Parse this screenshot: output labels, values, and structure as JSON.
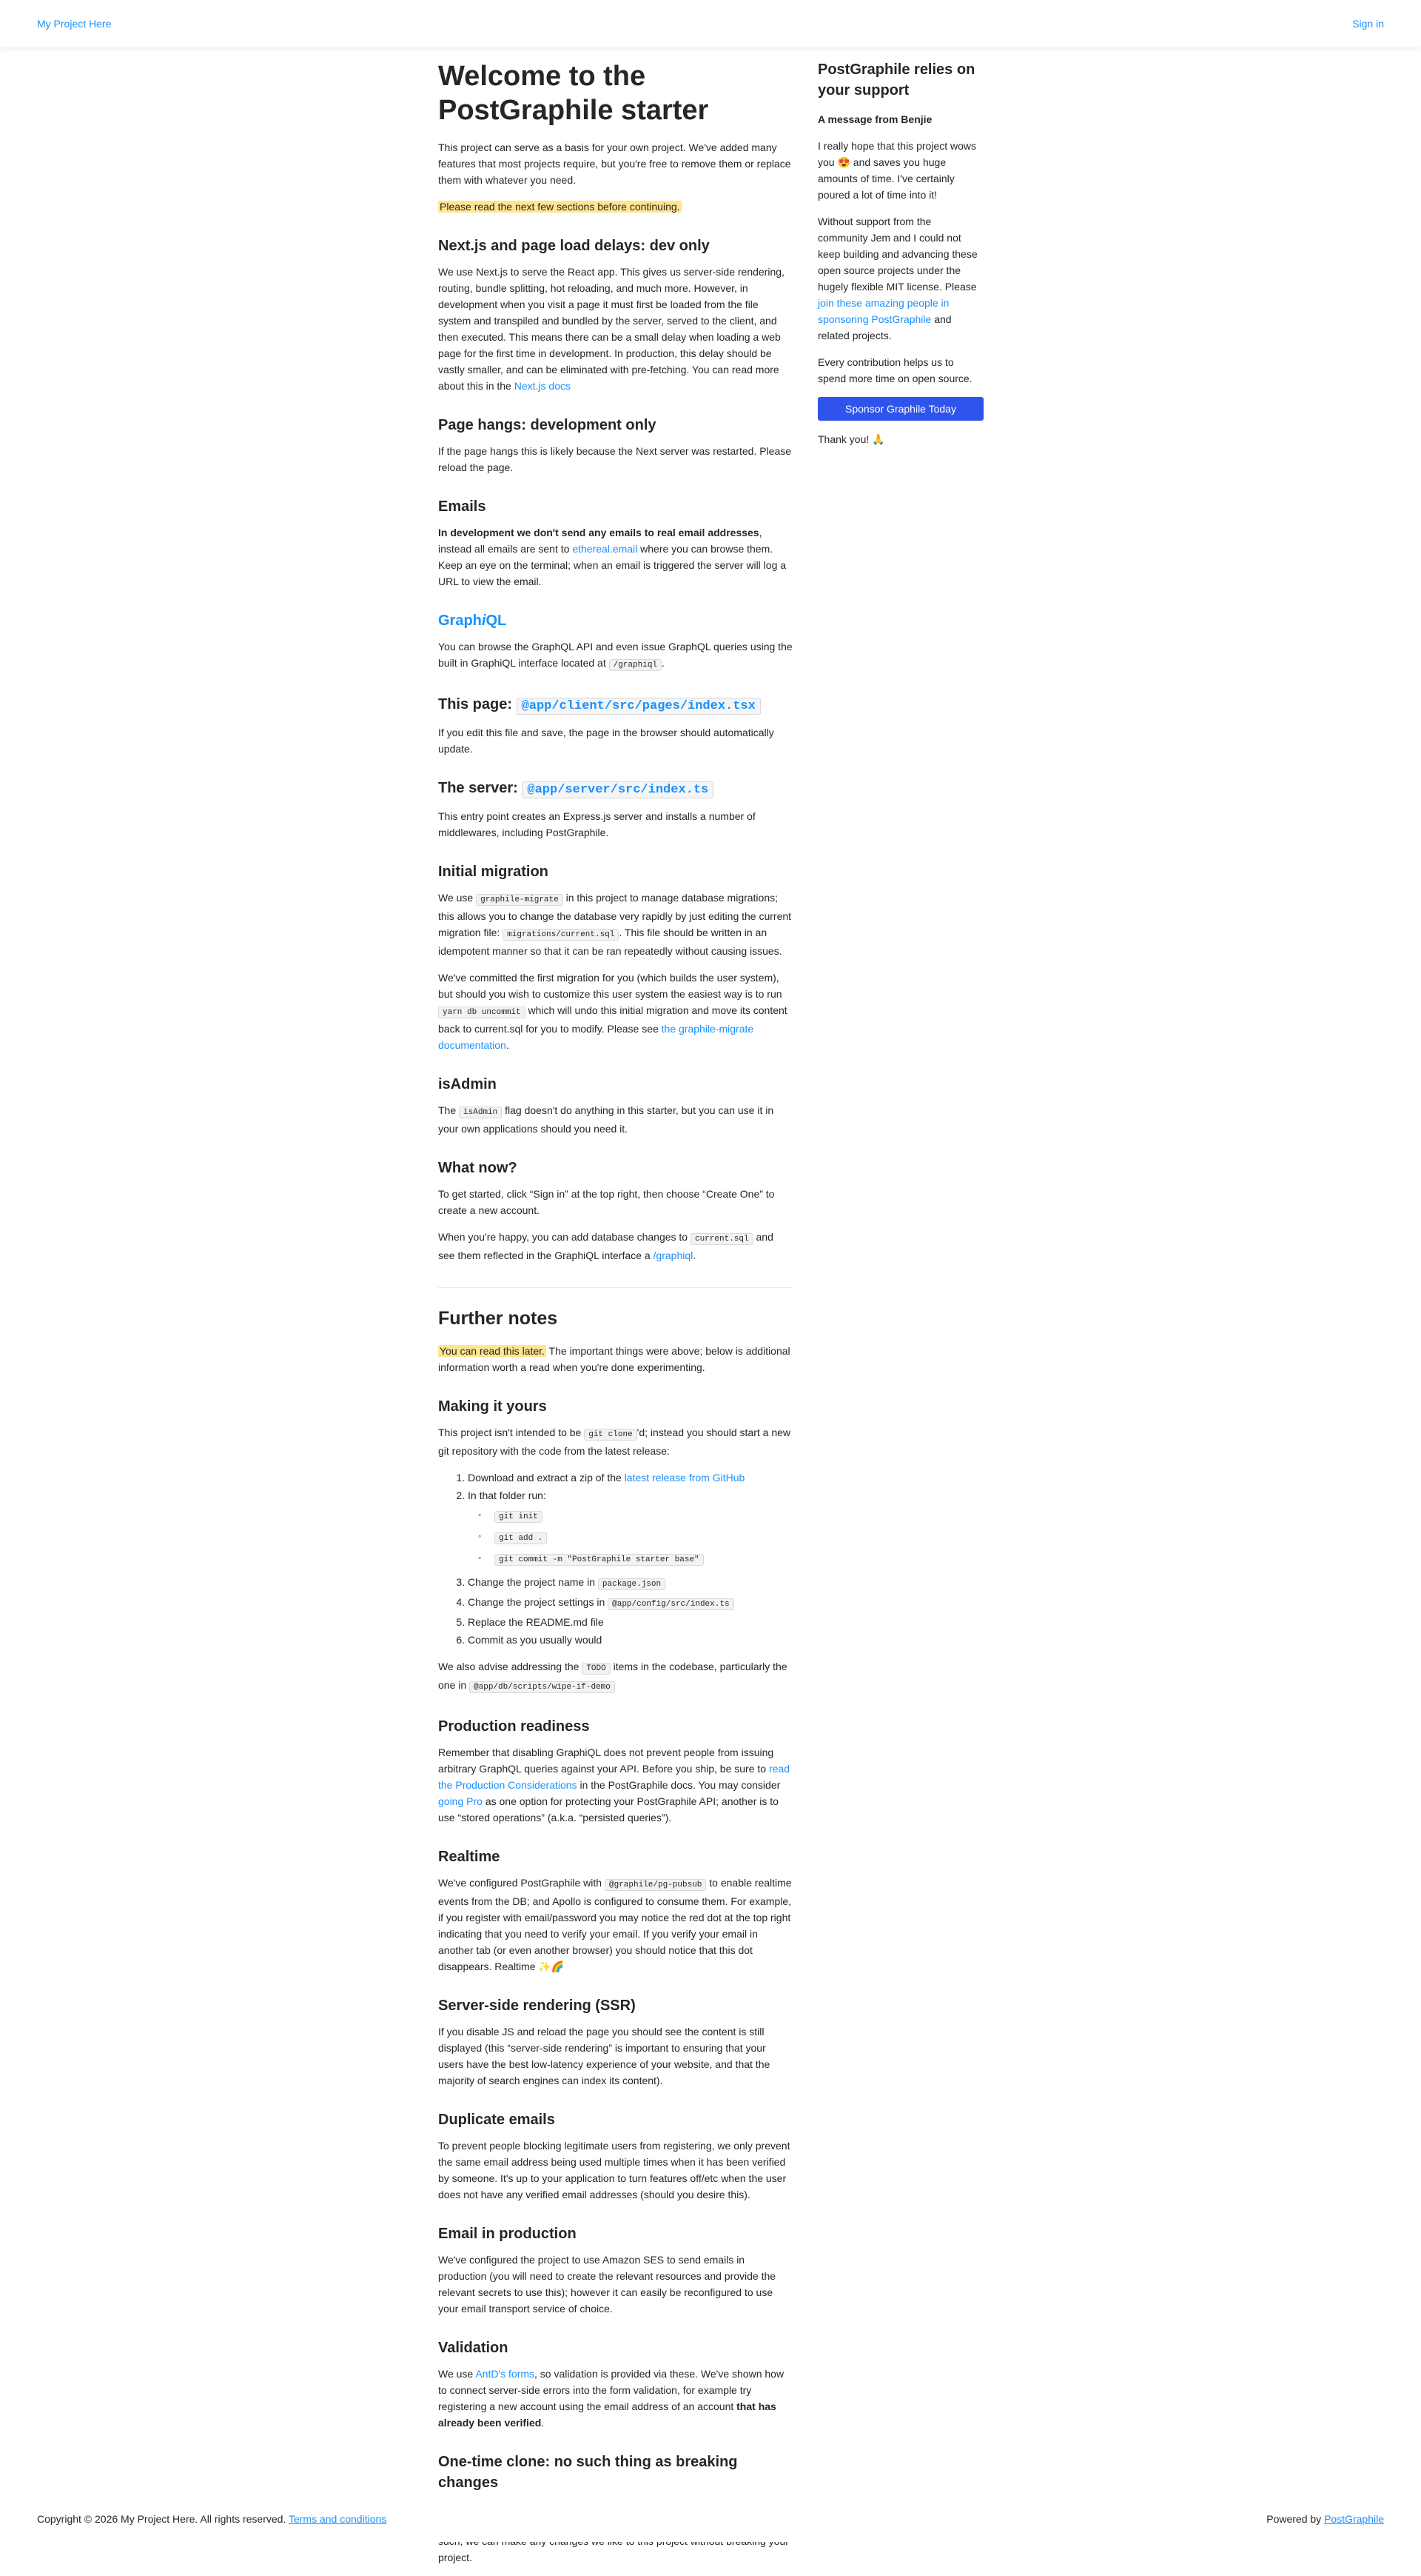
{
  "header": {
    "brand": "My Project Here",
    "signin": "Sign in"
  },
  "main": {
    "title": "Welcome to the PostGraphile starter",
    "intro": "This project can serve as a basis for your own project. We've added many features that most projects require, but you're free to remove them or replace them with whatever you need.",
    "notice": "Please read the next few sections before continuing.",
    "nextjs": {
      "heading": "Next.js and page load delays: dev only",
      "text": "We use Next.js to serve the React app. This gives us server-side rendering, routing, bundle splitting, hot reloading, and much more. However, in development when you visit a page it must first be loaded from the file system and transpiled and bundled by the server, served to the client, and then executed. This means there can be a small delay when loading a web page for the first time in development. In production, this delay should be vastly smaller, and can be eliminated with pre-fetching. You can read more about this in the ",
      "link": "Next.js docs"
    },
    "hangs": {
      "heading": "Page hangs: development only",
      "text": "If the page hangs this is likely because the Next server was restarted. Please reload the page."
    },
    "emails": {
      "heading": "Emails",
      "bold": "In development we don't send any emails to real email addresses",
      "text1": ", instead all emails are sent to ",
      "link": "ethereal.email",
      "text2": " where you can browse them. Keep an eye on the terminal; when an email is triggered the server will log a URL to view the email."
    },
    "graphiql": {
      "heading_a": "Graph",
      "heading_b": "i",
      "heading_c": "QL",
      "text": "You can browse the GraphQL API and even issue GraphQL queries using the built in GraphiQL interface located at ",
      "code": "/graphiql",
      "end": "."
    },
    "thispage": {
      "heading": "This page:",
      "code": "@app/client/src/pages/index.tsx",
      "text": "If you edit this file and save, the page in the browser should automatically update."
    },
    "server": {
      "heading": "The server:",
      "code": "@app/server/src/index.ts",
      "text": "This entry point creates an Express.js server and installs a number of middlewares, including PostGraphile."
    },
    "migration": {
      "heading": "Initial migration",
      "p1a": "We use ",
      "p1code": "graphile-migrate",
      "p1b": " in this project to manage database migrations; this allows you to change the database very rapidly by just editing the current migration file: ",
      "p1code2": "migrations/current.sql",
      "p1c": ". This file should be written in an idempotent manner so that it can be ran repeatedly without causing issues.",
      "p2a": "We've committed the first migration for you (which builds the user system), but should you wish to customize this user system the easiest way is to run ",
      "p2code": "yarn db uncommit",
      "p2b": " which will undo this initial migration and move its content back to current.sql for you to modify. Please see ",
      "p2link": "the graphile-migrate documentation",
      "p2c": "."
    },
    "isadmin": {
      "heading": "isAdmin",
      "a": "The ",
      "code": "isAdmin",
      "b": " flag doesn't do anything in this starter, but you can use it in your own applications should you need it."
    },
    "whatnow": {
      "heading": "What now?",
      "p1": "To get started, click “Sign in” at the top right, then choose “Create One” to create a new account.",
      "p2a": "When you're happy, you can add database changes to ",
      "p2code": "current.sql",
      "p2b": " and see them reflected in the GraphiQL interface a ",
      "p2link": "/graphiql",
      "p2c": "."
    },
    "further": {
      "heading": "Further notes",
      "hl": "You can read this later.",
      "text": " The important things were above; below is additional information worth a read when you're done experimenting."
    },
    "yours": {
      "heading": "Making it yours",
      "p1a": "This project isn't intended to be ",
      "p1code": "git clone",
      "p1b": "'d; instead you should start a new git repository with the code from the latest release:",
      "li1a": "Download and extract a zip of the ",
      "li1link": "latest release from GitHub",
      "li2": "In that folder run:",
      "cmd1": "git init",
      "cmd2": "git add .",
      "cmd3": "git commit -m \"PostGraphile starter base\"",
      "li3a": "Change the project name in ",
      "li3code": "package.json",
      "li4a": "Change the project settings in ",
      "li4code": "@app/config/src/index.ts",
      "li5": "Replace the README.md file",
      "li6": "Commit as you usually would",
      "p2a": "We also advise addressing the ",
      "p2code": "TODO",
      "p2b": " items in the codebase, particularly the one in ",
      "p2code2": "@app/db/scripts/wipe-if-demo"
    },
    "production": {
      "heading": "Production readiness",
      "a": "Remember that disabling GraphiQL does not prevent people from issuing arbitrary GraphQL queries against your API. Before you ship, be sure to ",
      "link1": "read the Production Considerations",
      "b": " in the PostGraphile docs. You may consider ",
      "link2": "going Pro",
      "c": " as one option for protecting your PostGraphile API; another is to use “stored operations” (a.k.a. “persisted queries”)."
    },
    "realtime": {
      "heading": "Realtime",
      "a": "We've configured PostGraphile with ",
      "code": "@graphile/pg-pubsub",
      "b": " to enable realtime events from the DB; and Apollo is configured to consume them. For example, if you register with email/password you may notice the red dot at the top right indicating that you need to verify your email. If you verify your email in another tab (or even another browser) you should notice that this dot disappears. Realtime ✨🌈"
    },
    "ssr": {
      "heading": "Server-side rendering (SSR)",
      "text": "If you disable JS and reload the page you should see the content is still displayed (this “server-side rendering” is important to ensuring that your users have the best low-latency experience of your website, and that the majority of search engines can index its content)."
    },
    "dupes": {
      "heading": "Duplicate emails",
      "text": "To prevent people blocking legitimate users from registering, we only prevent the same email address being used multiple times when it has been verified by someone. It's up to your application to turn features off/etc when the user does not have any verified email addresses (should you desire this)."
    },
    "emailprod": {
      "heading": "Email in production",
      "text": "We've configured the project to use Amazon SES to send emails in production (you will need to create the relevant resources and provide the relevant secrets to use this); however it can easily be reconfigured to use your email transport service of choice."
    },
    "validation": {
      "heading": "Validation",
      "a": "We use ",
      "link": "AntD's forms",
      "b": ", so validation is provided via these. We've shown how to connect server-side errors into the form validation, for example try registering a new account using the email address of an account ",
      "bold": "that has already been verified",
      "c": "."
    },
    "clone": {
      "heading": "One-time clone: no such thing as breaking changes",
      "text": "It's expected that you'll do a one-time clone of this project to base your project off, and that you will not keep your project up to date with this one. As such, we can make any changes we like to this project without breaking your project."
    }
  },
  "side": {
    "title": "PostGraphile relies on your support",
    "subtitle": "A message from Benjie",
    "p1": "I really hope that this project wows you 😍 and saves you huge amounts of time. I've certainly poured a lot of time into it!",
    "p2a": "Without support from the community Jem and I could not keep building and advancing these open source projects under the hugely flexible MIT license. Please ",
    "p2link": "join these amazing people in sponsoring PostGraphile",
    "p2b": " and related projects.",
    "p3": "Every contribution helps us to spend more time on open source.",
    "button": "Sponsor Graphile Today",
    "thanks": "Thank you! 🙏"
  },
  "footer": {
    "copy": "Copyright © 2026 My Project Here. All rights reserved. ",
    "terms": "Terms and conditions",
    "powered": "Powered by ",
    "powered_link": "PostGraphile"
  },
  "colors": {
    "link": "#1890ff",
    "button": "#2f54eb",
    "highlight": "#ffe58f"
  }
}
